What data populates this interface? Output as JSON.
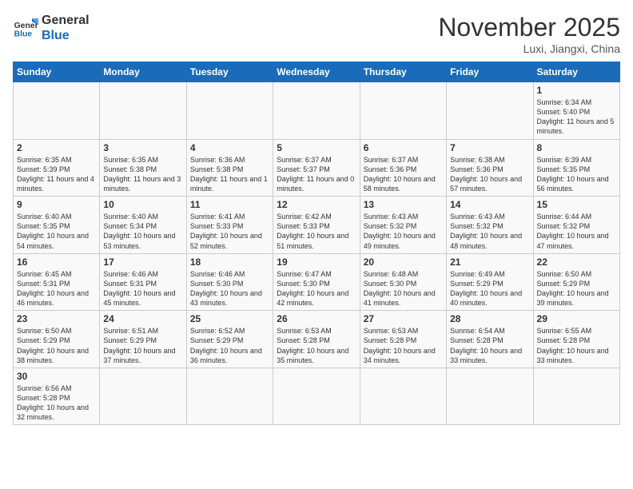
{
  "header": {
    "logo_general": "General",
    "logo_blue": "Blue",
    "month_title": "November 2025",
    "location": "Luxi, Jiangxi, China"
  },
  "weekdays": [
    "Sunday",
    "Monday",
    "Tuesday",
    "Wednesday",
    "Thursday",
    "Friday",
    "Saturday"
  ],
  "weeks": [
    [
      {
        "day": "",
        "info": ""
      },
      {
        "day": "",
        "info": ""
      },
      {
        "day": "",
        "info": ""
      },
      {
        "day": "",
        "info": ""
      },
      {
        "day": "",
        "info": ""
      },
      {
        "day": "",
        "info": ""
      },
      {
        "day": "1",
        "info": "Sunrise: 6:34 AM\nSunset: 5:40 PM\nDaylight: 11 hours and 5 minutes."
      }
    ],
    [
      {
        "day": "2",
        "info": "Sunrise: 6:35 AM\nSunset: 5:39 PM\nDaylight: 11 hours and 4 minutes."
      },
      {
        "day": "3",
        "info": "Sunrise: 6:35 AM\nSunset: 5:38 PM\nDaylight: 11 hours and 3 minutes."
      },
      {
        "day": "4",
        "info": "Sunrise: 6:36 AM\nSunset: 5:38 PM\nDaylight: 11 hours and 1 minute."
      },
      {
        "day": "5",
        "info": "Sunrise: 6:37 AM\nSunset: 5:37 PM\nDaylight: 11 hours and 0 minutes."
      },
      {
        "day": "6",
        "info": "Sunrise: 6:37 AM\nSunset: 5:36 PM\nDaylight: 10 hours and 58 minutes."
      },
      {
        "day": "7",
        "info": "Sunrise: 6:38 AM\nSunset: 5:36 PM\nDaylight: 10 hours and 57 minutes."
      },
      {
        "day": "8",
        "info": "Sunrise: 6:39 AM\nSunset: 5:35 PM\nDaylight: 10 hours and 56 minutes."
      }
    ],
    [
      {
        "day": "9",
        "info": "Sunrise: 6:40 AM\nSunset: 5:35 PM\nDaylight: 10 hours and 54 minutes."
      },
      {
        "day": "10",
        "info": "Sunrise: 6:40 AM\nSunset: 5:34 PM\nDaylight: 10 hours and 53 minutes."
      },
      {
        "day": "11",
        "info": "Sunrise: 6:41 AM\nSunset: 5:33 PM\nDaylight: 10 hours and 52 minutes."
      },
      {
        "day": "12",
        "info": "Sunrise: 6:42 AM\nSunset: 5:33 PM\nDaylight: 10 hours and 51 minutes."
      },
      {
        "day": "13",
        "info": "Sunrise: 6:43 AM\nSunset: 5:32 PM\nDaylight: 10 hours and 49 minutes."
      },
      {
        "day": "14",
        "info": "Sunrise: 6:43 AM\nSunset: 5:32 PM\nDaylight: 10 hours and 48 minutes."
      },
      {
        "day": "15",
        "info": "Sunrise: 6:44 AM\nSunset: 5:32 PM\nDaylight: 10 hours and 47 minutes."
      }
    ],
    [
      {
        "day": "16",
        "info": "Sunrise: 6:45 AM\nSunset: 5:31 PM\nDaylight: 10 hours and 46 minutes."
      },
      {
        "day": "17",
        "info": "Sunrise: 6:46 AM\nSunset: 5:31 PM\nDaylight: 10 hours and 45 minutes."
      },
      {
        "day": "18",
        "info": "Sunrise: 6:46 AM\nSunset: 5:30 PM\nDaylight: 10 hours and 43 minutes."
      },
      {
        "day": "19",
        "info": "Sunrise: 6:47 AM\nSunset: 5:30 PM\nDaylight: 10 hours and 42 minutes."
      },
      {
        "day": "20",
        "info": "Sunrise: 6:48 AM\nSunset: 5:30 PM\nDaylight: 10 hours and 41 minutes."
      },
      {
        "day": "21",
        "info": "Sunrise: 6:49 AM\nSunset: 5:29 PM\nDaylight: 10 hours and 40 minutes."
      },
      {
        "day": "22",
        "info": "Sunrise: 6:50 AM\nSunset: 5:29 PM\nDaylight: 10 hours and 39 minutes."
      }
    ],
    [
      {
        "day": "23",
        "info": "Sunrise: 6:50 AM\nSunset: 5:29 PM\nDaylight: 10 hours and 38 minutes."
      },
      {
        "day": "24",
        "info": "Sunrise: 6:51 AM\nSunset: 5:29 PM\nDaylight: 10 hours and 37 minutes."
      },
      {
        "day": "25",
        "info": "Sunrise: 6:52 AM\nSunset: 5:29 PM\nDaylight: 10 hours and 36 minutes."
      },
      {
        "day": "26",
        "info": "Sunrise: 6:53 AM\nSunset: 5:28 PM\nDaylight: 10 hours and 35 minutes."
      },
      {
        "day": "27",
        "info": "Sunrise: 6:53 AM\nSunset: 5:28 PM\nDaylight: 10 hours and 34 minutes."
      },
      {
        "day": "28",
        "info": "Sunrise: 6:54 AM\nSunset: 5:28 PM\nDaylight: 10 hours and 33 minutes."
      },
      {
        "day": "29",
        "info": "Sunrise: 6:55 AM\nSunset: 5:28 PM\nDaylight: 10 hours and 33 minutes."
      }
    ],
    [
      {
        "day": "30",
        "info": "Sunrise: 6:56 AM\nSunset: 5:28 PM\nDaylight: 10 hours and 32 minutes."
      },
      {
        "day": "",
        "info": ""
      },
      {
        "day": "",
        "info": ""
      },
      {
        "day": "",
        "info": ""
      },
      {
        "day": "",
        "info": ""
      },
      {
        "day": "",
        "info": ""
      },
      {
        "day": "",
        "info": ""
      }
    ]
  ]
}
